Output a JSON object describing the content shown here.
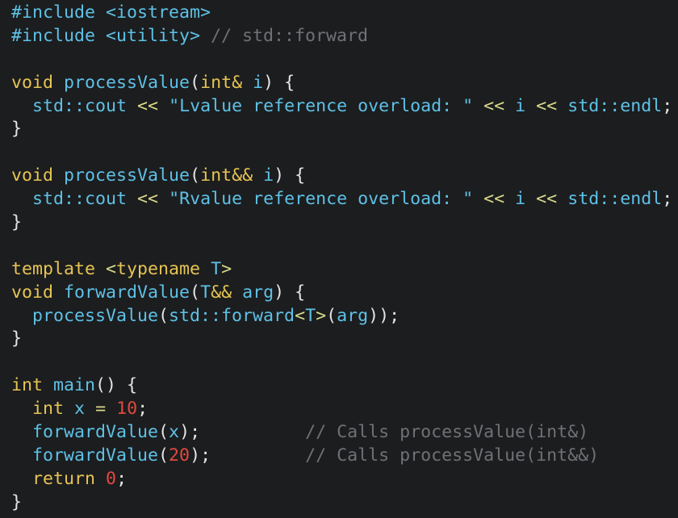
{
  "colors": {
    "background": "#1c1d1f",
    "keyword": "#e6c453",
    "function": "#5ec1e6",
    "string": "#5ec1e6",
    "number": "#e04a3f",
    "comment": "#6f7175",
    "operator": "#d9d98a",
    "plain": "#e4e4e4"
  },
  "lines": [
    [
      [
        "include",
        "#include <iostream>"
      ]
    ],
    [
      [
        "include",
        "#include <utility>"
      ],
      [
        "plain",
        " "
      ],
      [
        "comment",
        "// std::forward"
      ]
    ],
    [],
    [
      [
        "keyword",
        "void"
      ],
      [
        "plain",
        " "
      ],
      [
        "func",
        "processValue"
      ],
      [
        "plain",
        "("
      ],
      [
        "keyword",
        "int&"
      ],
      [
        "plain",
        " "
      ],
      [
        "param",
        "i"
      ],
      [
        "plain",
        ") {"
      ]
    ],
    [
      [
        "plain",
        "  "
      ],
      [
        "ident",
        "std::cout"
      ],
      [
        "plain",
        " "
      ],
      [
        "op",
        "<<"
      ],
      [
        "plain",
        " "
      ],
      [
        "string",
        "\"Lvalue reference overload: \""
      ],
      [
        "plain",
        " "
      ],
      [
        "op",
        "<<"
      ],
      [
        "plain",
        " "
      ],
      [
        "param",
        "i"
      ],
      [
        "plain",
        " "
      ],
      [
        "op",
        "<<"
      ],
      [
        "plain",
        " "
      ],
      [
        "ident",
        "std::endl"
      ],
      [
        "plain",
        ";"
      ]
    ],
    [
      [
        "plain",
        "}"
      ]
    ],
    [],
    [
      [
        "keyword",
        "void"
      ],
      [
        "plain",
        " "
      ],
      [
        "func",
        "processValue"
      ],
      [
        "plain",
        "("
      ],
      [
        "keyword",
        "int&&"
      ],
      [
        "plain",
        " "
      ],
      [
        "param",
        "i"
      ],
      [
        "plain",
        ") {"
      ]
    ],
    [
      [
        "plain",
        "  "
      ],
      [
        "ident",
        "std::cout"
      ],
      [
        "plain",
        " "
      ],
      [
        "op",
        "<<"
      ],
      [
        "plain",
        " "
      ],
      [
        "string",
        "\"Rvalue reference overload: \""
      ],
      [
        "plain",
        " "
      ],
      [
        "op",
        "<<"
      ],
      [
        "plain",
        " "
      ],
      [
        "param",
        "i"
      ],
      [
        "plain",
        " "
      ],
      [
        "op",
        "<<"
      ],
      [
        "plain",
        " "
      ],
      [
        "ident",
        "std::endl"
      ],
      [
        "plain",
        ";"
      ]
    ],
    [
      [
        "plain",
        "}"
      ]
    ],
    [],
    [
      [
        "keyword",
        "template"
      ],
      [
        "plain",
        " "
      ],
      [
        "op",
        "<"
      ],
      [
        "keyword",
        "typename"
      ],
      [
        "plain",
        " "
      ],
      [
        "ident",
        "T"
      ],
      [
        "op",
        ">"
      ]
    ],
    [
      [
        "keyword",
        "void"
      ],
      [
        "plain",
        " "
      ],
      [
        "func",
        "forwardValue"
      ],
      [
        "plain",
        "("
      ],
      [
        "ident",
        "T"
      ],
      [
        "keyword",
        "&&"
      ],
      [
        "plain",
        " "
      ],
      [
        "param",
        "arg"
      ],
      [
        "plain",
        ") {"
      ]
    ],
    [
      [
        "plain",
        "  "
      ],
      [
        "func",
        "processValue"
      ],
      [
        "plain",
        "("
      ],
      [
        "ident",
        "std::forward"
      ],
      [
        "op",
        "<"
      ],
      [
        "ident",
        "T"
      ],
      [
        "op",
        ">"
      ],
      [
        "plain",
        "("
      ],
      [
        "param",
        "arg"
      ],
      [
        "plain",
        "));"
      ]
    ],
    [
      [
        "plain",
        "}"
      ]
    ],
    [],
    [
      [
        "keyword",
        "int"
      ],
      [
        "plain",
        " "
      ],
      [
        "func",
        "main"
      ],
      [
        "plain",
        "() {"
      ]
    ],
    [
      [
        "plain",
        "  "
      ],
      [
        "keyword",
        "int"
      ],
      [
        "plain",
        " "
      ],
      [
        "ident",
        "x"
      ],
      [
        "plain",
        " "
      ],
      [
        "op",
        "="
      ],
      [
        "plain",
        " "
      ],
      [
        "number",
        "10"
      ],
      [
        "plain",
        ";"
      ]
    ],
    [
      [
        "plain",
        "  "
      ],
      [
        "func",
        "forwardValue"
      ],
      [
        "plain",
        "("
      ],
      [
        "ident",
        "x"
      ],
      [
        "plain",
        ");"
      ],
      [
        "plain",
        "          "
      ],
      [
        "comment",
        "// Calls processValue(int&)"
      ]
    ],
    [
      [
        "plain",
        "  "
      ],
      [
        "func",
        "forwardValue"
      ],
      [
        "plain",
        "("
      ],
      [
        "number",
        "20"
      ],
      [
        "plain",
        ");"
      ],
      [
        "plain",
        "         "
      ],
      [
        "comment",
        "// Calls processValue(int&&)"
      ]
    ],
    [
      [
        "plain",
        "  "
      ],
      [
        "keyword",
        "return"
      ],
      [
        "plain",
        " "
      ],
      [
        "number",
        "0"
      ],
      [
        "plain",
        ";"
      ]
    ],
    [
      [
        "plain",
        "}"
      ]
    ]
  ]
}
